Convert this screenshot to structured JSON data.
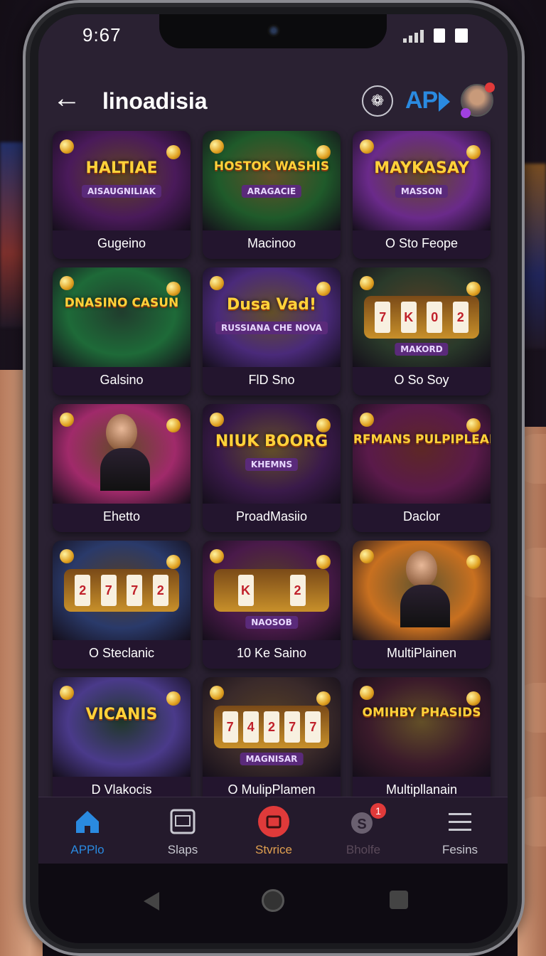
{
  "status_bar": {
    "time": "9:67"
  },
  "header": {
    "back_icon": "arrow-left-icon",
    "title": "linoadisia",
    "brand_badge": "AP"
  },
  "games": [
    {
      "label": "Gugeino",
      "logo": "HALTIAE",
      "sub": "AISAUGNILIAK",
      "theme": "#4a1a5a",
      "accent": "#e0a020"
    },
    {
      "label": "Macinoo",
      "logo": "HOSTOK WASHIS",
      "sub": "ARAGACIE",
      "theme": "#1f5a2a",
      "accent": "#f0c030"
    },
    {
      "label": "O Sto Feope",
      "logo": "MAYKASAY",
      "sub": "MASSON",
      "theme": "#6a2a8a",
      "accent": "#f0b030"
    },
    {
      "label": "Galsino",
      "logo": "DNASINO CASUN",
      "sub": "",
      "theme": "#1e6a38",
      "accent": "#2a8a40"
    },
    {
      "label": "FlD Sno",
      "logo": "Dusa Vad!",
      "sub": "RUSSIANA CHE NOVA",
      "theme": "#4a2a7a",
      "accent": "#f0c030"
    },
    {
      "label": "O So Soy",
      "logo": "7 K 0 2",
      "sub": "MAKORD",
      "theme": "#2a3a2a",
      "accent": "#c8902a"
    },
    {
      "label": "Ehetto",
      "logo": "",
      "sub": "",
      "theme": "#a02a6a",
      "accent": "#f0b030"
    },
    {
      "label": "ProadMasiio",
      "logo": "NIUK BOORG",
      "sub": "KHEMNS",
      "theme": "#3a1a4a",
      "accent": "#f0c030"
    },
    {
      "label": "Daclor",
      "logo": "PERFMANS PULPIPLEARS",
      "sub": "",
      "theme": "#5a1a4a",
      "accent": "#e04a2a"
    },
    {
      "label": "O Steclanic",
      "logo": "2 7 7 2",
      "sub": "",
      "theme": "#2a3a6a",
      "accent": "#c8902a"
    },
    {
      "label": "10 Ke Saino",
      "logo": "K 2",
      "sub": "NAOSOB",
      "theme": "#4a1a4a",
      "accent": "#c8902a"
    },
    {
      "label": "MultiPlainen",
      "logo": "",
      "sub": "",
      "theme": "#c87020",
      "accent": "#f0d040"
    },
    {
      "label": "D Vlakocis",
      "logo": "VICANIS",
      "sub": "",
      "theme": "#4a3a8a",
      "accent": "#2a7a3a"
    },
    {
      "label": "O MulipPlamen",
      "logo": "7 4 2 7 7",
      "sub": "MAGNISAR",
      "theme": "#3a2a2a",
      "accent": "#c8902a"
    },
    {
      "label": "Multipllanain",
      "logo": "OMIHBY PHASIDS",
      "sub": "",
      "theme": "#3a1a2a",
      "accent": "#f0c030"
    }
  ],
  "nav": [
    {
      "label": "APPlo",
      "icon": "home-icon",
      "color": "#2a8ae0",
      "active": true
    },
    {
      "label": "Slaps",
      "icon": "tablet-icon",
      "color": "#c8c8d0"
    },
    {
      "label": "Stvrice",
      "icon": "store-icon",
      "color": "#e0a050"
    },
    {
      "label": "Bholfe",
      "icon": "chat-icon",
      "color": "#5a4a5a",
      "badge": "1"
    },
    {
      "label": "Fesins",
      "icon": "menu-icon",
      "color": "#c8c8d0"
    }
  ]
}
